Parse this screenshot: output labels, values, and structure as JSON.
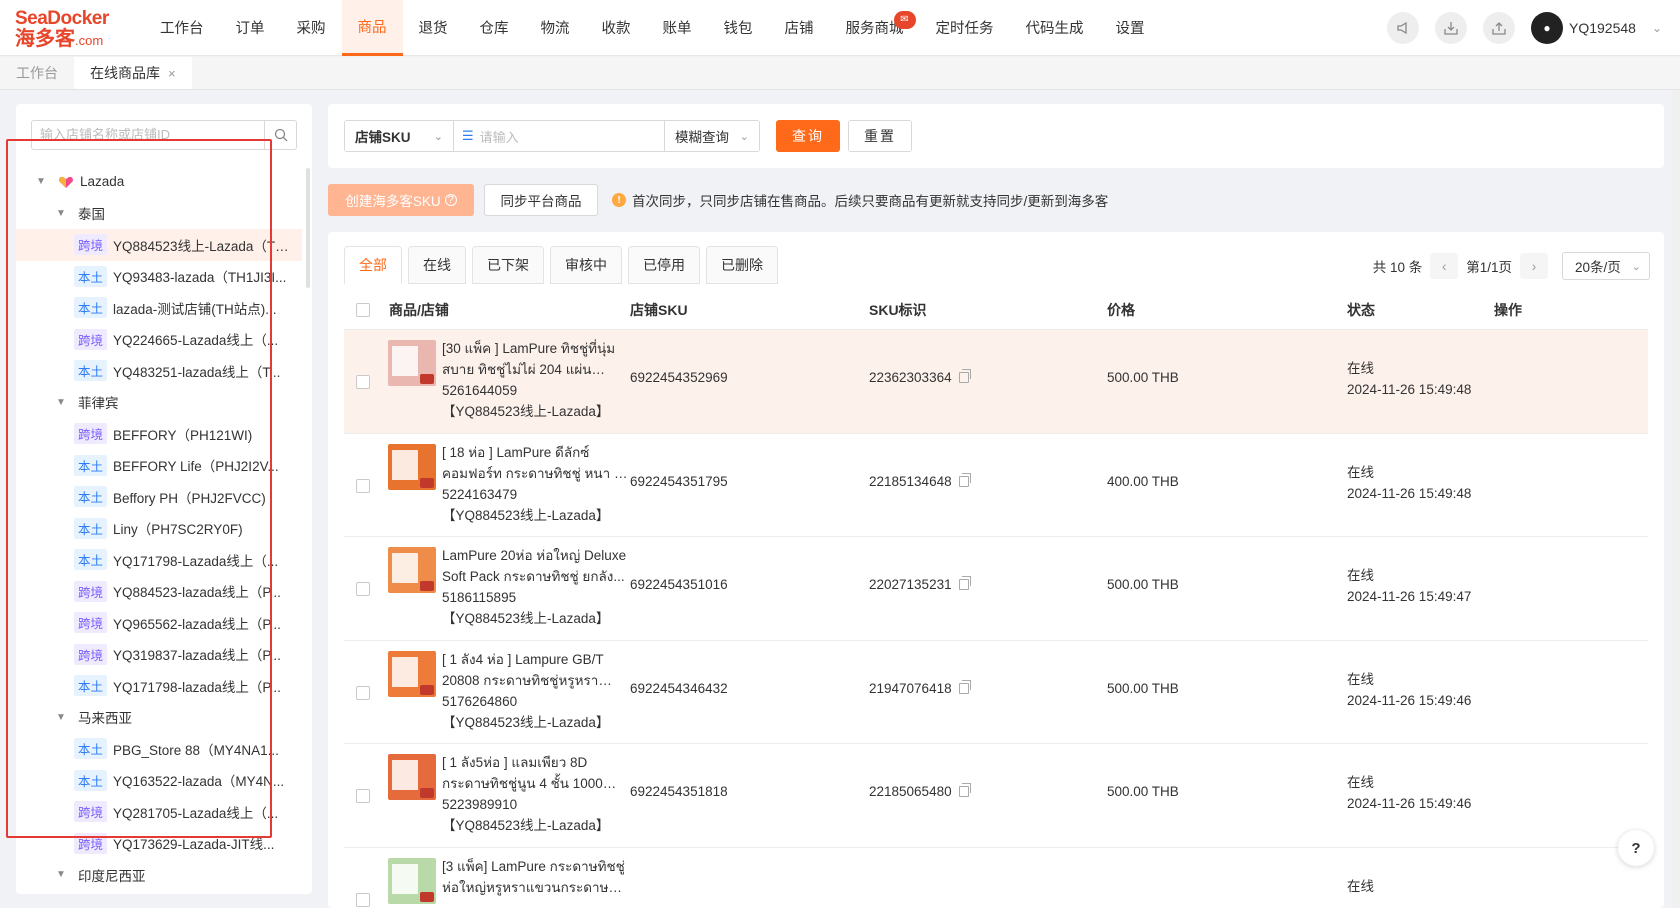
{
  "logo": {
    "line1": "SeaDocker",
    "line2": "海多客",
    "suffix": ".com"
  },
  "nav": [
    {
      "label": "工作台",
      "active": false
    },
    {
      "label": "订单",
      "active": false
    },
    {
      "label": "采购",
      "active": false
    },
    {
      "label": "商品",
      "active": true
    },
    {
      "label": "退货",
      "active": false
    },
    {
      "label": "仓库",
      "active": false
    },
    {
      "label": "物流",
      "active": false
    },
    {
      "label": "收款",
      "active": false
    },
    {
      "label": "账单",
      "active": false
    },
    {
      "label": "钱包",
      "active": false
    },
    {
      "label": "店铺",
      "active": false
    },
    {
      "label": "服务商城",
      "active": false
    },
    {
      "label": "定时任务",
      "active": false
    },
    {
      "label": "代码生成",
      "active": false
    },
    {
      "label": "设置",
      "active": false
    }
  ],
  "user": {
    "name": "YQ192548"
  },
  "page_tabs": [
    {
      "label": "工作台",
      "active": false
    },
    {
      "label": "在线商品库",
      "active": true,
      "close": "×"
    }
  ],
  "store_search": {
    "placeholder": "输入店铺名称或店铺ID"
  },
  "tree": {
    "platform": "Lazada",
    "groups": [
      {
        "country": "泰国",
        "stores": [
          {
            "tag": "跨境",
            "name": "YQ884523线上-Lazada（TH...",
            "selected": true
          },
          {
            "tag": "本土",
            "name": "YQ93483-lazada（TH1JI3I..."
          },
          {
            "tag": "本土",
            "name": "lazada-测试店铺(TH站点)..."
          },
          {
            "tag": "跨境",
            "name": "YQ224665-Lazada线上（..."
          },
          {
            "tag": "本土",
            "name": "YQ483251-lazada线上（T..."
          }
        ]
      },
      {
        "country": "菲律宾",
        "stores": [
          {
            "tag": "跨境",
            "name": "BEFFORY（PH121WI)"
          },
          {
            "tag": "本土",
            "name": "BEFFORY Life（PHJ2I2V..."
          },
          {
            "tag": "本土",
            "name": "Beffory PH（PHJ2FVCC)"
          },
          {
            "tag": "本土",
            "name": "Liny（PH7SC2RY0F)"
          },
          {
            "tag": "本土",
            "name": "YQ171798-Lazada线上（..."
          },
          {
            "tag": "跨境",
            "name": "YQ884523-lazada线上（P..."
          },
          {
            "tag": "跨境",
            "name": "YQ965562-lazada线上（P..."
          },
          {
            "tag": "跨境",
            "name": "YQ319837-lazada线上（P..."
          },
          {
            "tag": "本土",
            "name": "YQ171798-lazada线上（P..."
          }
        ]
      },
      {
        "country": "马来西亚",
        "stores": [
          {
            "tag": "本土",
            "name": "PBG_Store 88（MY4NA1..."
          },
          {
            "tag": "本土",
            "name": "YQ163522-lazada（MY4N..."
          },
          {
            "tag": "跨境",
            "name": "YQ281705-Lazada线上（..."
          },
          {
            "tag": "跨境",
            "name": "YQ173629-Lazada-JIT线..."
          }
        ]
      },
      {
        "country": "印度尼西亚",
        "stores": []
      }
    ]
  },
  "filter": {
    "field": "店铺SKU",
    "placeholder": "请输入",
    "mode": "模糊查询",
    "query_label": "查询",
    "reset_label": "重置"
  },
  "actions": {
    "create_label": "创建海多客SKU",
    "sync_label": "同步平台商品",
    "notice": "首次同步，只同步店铺在售商品。后续只要商品有更新就支持同步/更新到海多客"
  },
  "status_tabs": [
    "全部",
    "在线",
    "已下架",
    "审核中",
    "已停用",
    "已删除"
  ],
  "pagination": {
    "total": "共 10 条",
    "page": "第1/1页",
    "size": "20条/页"
  },
  "columns": [
    "商品/店铺",
    "店铺SKU",
    "SKU标识",
    "价格",
    "状态",
    "操作"
  ],
  "rows": [
    {
      "title": "[30 แพ็ค ] LamPure ทิชชู่ที่นุ่มสบาย ทิชชู่ไม่ไผ่ 204 แผ่น กระดาษ...",
      "item_id": "5261644059",
      "store": "【YQ884523线上-Lazada】",
      "shop_sku": "6922454352969",
      "sku_id": "22362303364",
      "price": "500.00 THB",
      "status": "在线",
      "time": "2024-11-26 15:49:48",
      "highlight": true,
      "thumb_color": "#e9b7b0"
    },
    {
      "title": "[ 18 ห่อ ] LamPure ดีลักซ์ คอมฟอร์ท กระดาษทิชชู่ หนา 5 ชั้น...",
      "item_id": "5224163479",
      "store": "【YQ884523线上-Lazada】",
      "shop_sku": "6922454351795",
      "sku_id": "22185134648",
      "price": "400.00 THB",
      "status": "在线",
      "time": "2024-11-26 15:49:48",
      "highlight": false,
      "thumb_color": "#e8732f"
    },
    {
      "title": "LamPure 20ห่อ ห่อใหญ่ Deluxe Soft Pack กระดาษทิชชู่ ยกลัง...",
      "item_id": "5186115895",
      "store": "【YQ884523线上-Lazada】",
      "shop_sku": "6922454351016",
      "sku_id": "22027135231",
      "price": "500.00 THB",
      "status": "在线",
      "time": "2024-11-26 15:49:47",
      "highlight": false,
      "thumb_color": "#ef8c4a"
    },
    {
      "title": "[ 1 ลัง4 ห่อ ] Lampure GB/T 20808 กระดาษทิชชู่หรูหราสะอาด...",
      "item_id": "5176264860",
      "store": "【YQ884523线上-Lazada】",
      "shop_sku": "6922454346432",
      "sku_id": "21947076418",
      "price": "500.00 THB",
      "status": "在线",
      "time": "2024-11-26 15:49:46",
      "highlight": false,
      "thumb_color": "#ee7b3a"
    },
    {
      "title": "[ 1 ลัง5ห่อ ] แลมเพียว 8D กระดาษทิชชู่นูน 4 ชั้น 1000 แผ่นแพ็ค...",
      "item_id": "5223989910",
      "store": "【YQ884523线上-Lazada】",
      "shop_sku": "6922454351818",
      "sku_id": "22185065480",
      "price": "500.00 THB",
      "status": "在线",
      "time": "2024-11-26 15:49:46",
      "highlight": false,
      "thumb_color": "#e56a3c"
    },
    {
      "title": "[3 แพ็ค] LamPure กระดาษทิชชู่ห่อใหญ่หรูหราแขวนกระดาษทิชชู่...",
      "item_id": "",
      "store": "",
      "shop_sku": "",
      "sku_id": "",
      "price": "",
      "status": "在线",
      "time": "",
      "highlight": false,
      "thumb_color": "#b9d9a8"
    }
  ],
  "help": "?",
  "colors": {
    "accent": "#ff6a1a",
    "highlight": "#e53935",
    "cross_border_tag": "#7b61ff",
    "local_tag": "#2f7cf6"
  }
}
